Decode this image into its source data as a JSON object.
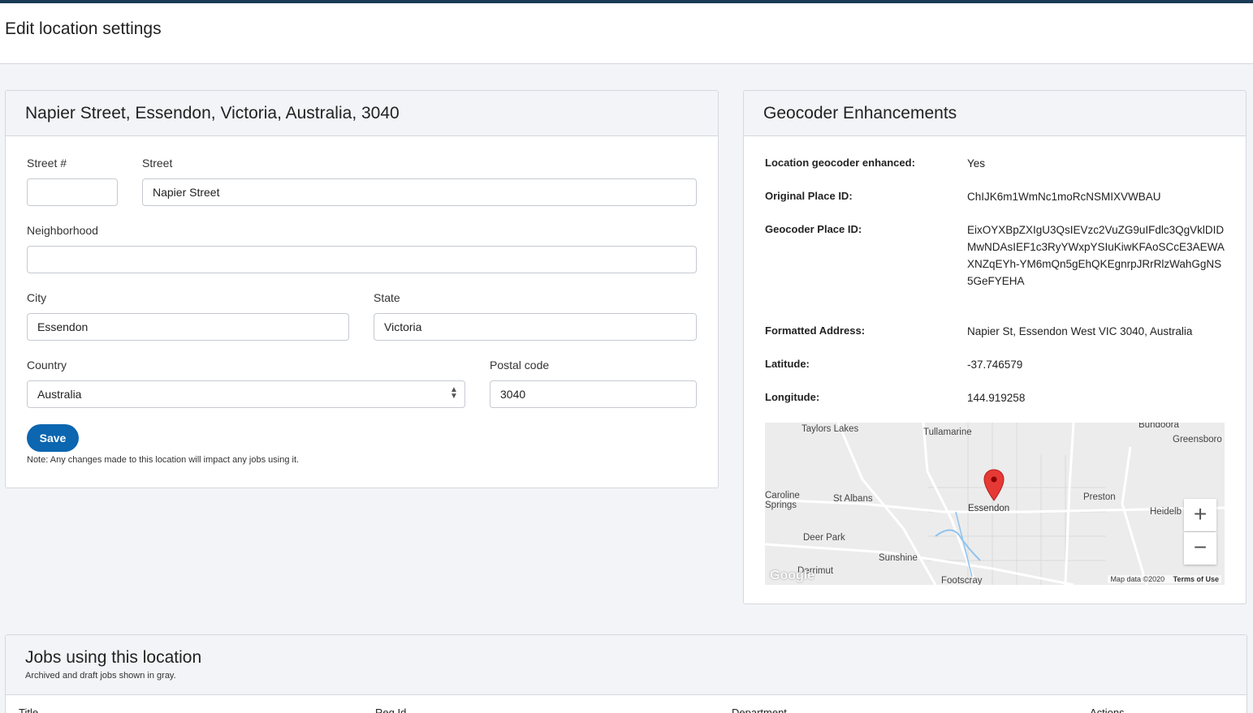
{
  "page": {
    "title": "Edit location settings"
  },
  "address_card": {
    "title": "Napier Street, Essendon, Victoria, Australia, 3040",
    "street_no_label": "Street #",
    "street_no_value": "",
    "street_label": "Street",
    "street_value": "Napier Street",
    "neighborhood_label": "Neighborhood",
    "neighborhood_value": "",
    "city_label": "City",
    "city_value": "Essendon",
    "state_label": "State",
    "state_value": "Victoria",
    "country_label": "Country",
    "country_value": "Australia",
    "postal_label": "Postal code",
    "postal_value": "3040",
    "save_label": "Save",
    "note": "Note: Any changes made to this location will impact any jobs using it."
  },
  "geo_card": {
    "title": "Geocoder Enhancements",
    "rows": [
      {
        "key": "Location geocoder enhanced:",
        "value": "Yes"
      },
      {
        "key": "Original Place ID:",
        "value": "ChIJK6m1WmNc1moRcNSMIXVWBAU"
      },
      {
        "key": "Geocoder Place ID:",
        "value": "EixOYXBpZXIgU3QsIEVzc2VuZG9uIFdlc3QgVklDIDMwNDAsIEF1c3RyYWxpYSIuKiwKFAoSCcE3AEWAXNZqEYh-YM6mQn5gEhQKEgnrpJRrRlzWahGgNS5GeFYEHA"
      },
      {
        "key": "Formatted Address:",
        "value": "Napier St, Essendon West VIC 3040, Australia"
      },
      {
        "key": "Latitude:",
        "value": "-37.746579"
      },
      {
        "key": "Longitude:",
        "value": "144.919258"
      }
    ],
    "map": {
      "places": {
        "taylors_lakes": "Taylors Lakes",
        "tullamarine": "Tullamarine",
        "bundoora": "Bundoora",
        "greensborough": "Greensboro",
        "caroline_springs": "Caroline Springs",
        "st_albans": "St Albans",
        "essendon": "Essendon",
        "preston": "Preston",
        "heidelberg": "Heidelb",
        "deer_park": "Deer Park",
        "sunshine": "Sunshine",
        "footscray": "Footscray",
        "derrimut": "Derrimut"
      },
      "zoom_in": "+",
      "zoom_out": "−",
      "map_data": "Map data ©2020",
      "terms": "Terms of Use",
      "logo": "Google"
    }
  },
  "jobs_card": {
    "title": "Jobs using this location",
    "subtitle": "Archived and draft jobs shown in gray.",
    "columns": [
      "Title",
      "Req Id",
      "Department",
      "Actions"
    ]
  },
  "colors": {
    "primary": "#0c66b0",
    "topbar": "#1b3a57",
    "pin": "#e53935"
  }
}
